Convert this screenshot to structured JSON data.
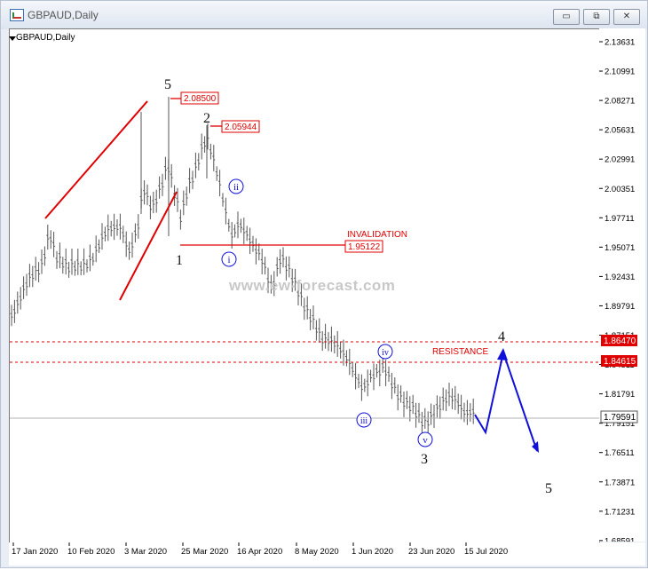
{
  "window": {
    "title": "GBPAUD,Daily",
    "buttons": {
      "minimize": "▭",
      "restore": "⧉",
      "close": "✕"
    }
  },
  "chart": {
    "symbol_label": "GBPAUD,Daily",
    "watermark": "www.ew-forecast.com",
    "price_ticks": [
      "2.13631",
      "2.10991",
      "2.08271",
      "2.05631",
      "2.02991",
      "2.00351",
      "1.97711",
      "1.95071",
      "1.92431",
      "1.89791",
      "1.87151",
      "1.84511",
      "1.81791",
      "1.79151",
      "1.76511",
      "1.73871",
      "1.71231",
      "1.68591"
    ],
    "date_ticks": [
      "17 Jan 2020",
      "10 Feb 2020",
      "3 Mar 2020",
      "25 Mar 2020",
      "16 Apr 2020",
      "8 May 2020",
      "1 Jun 2020",
      "23 Jun 2020",
      "15 Jul 2020"
    ],
    "price_labels": {
      "high_5": "2.08500",
      "high_2": "2.05944",
      "invalidation": "1.95122",
      "resistance_upper": "1.86470",
      "resistance_lower": "1.84615",
      "current": "1.79591"
    },
    "annotations": {
      "invalidation": "INVALIDATION",
      "resistance": "RESISTANCE"
    },
    "wave_labels": {
      "w5_top": "5",
      "w2": "2",
      "w1": "1",
      "wii": "ii",
      "wi": "i",
      "wiii": "iii",
      "wiv": "iv",
      "wv": "v",
      "w3": "3",
      "w4": "4",
      "w5_bottom": "5"
    },
    "colors": {
      "red": "#e00000",
      "blue": "#1010d8",
      "candle": "#555555",
      "current_line": "#b0b0b0"
    }
  }
}
